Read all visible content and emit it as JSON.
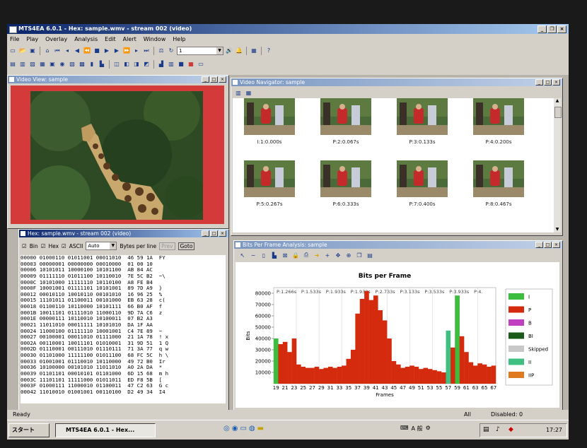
{
  "app": {
    "title": "MTS4EA 6.0.1 - Hex: sample.wmv - stream 002 (video)"
  },
  "menu": [
    "File",
    "Play",
    "Overlay",
    "Analysis",
    "Edit",
    "Alert",
    "Window",
    "Help"
  ],
  "toolbar": {
    "speed_value": "1"
  },
  "video_view": {
    "title": "Video View: sample"
  },
  "navigator": {
    "title": "Video Navigator: sample",
    "thumbs": [
      "I:1:0.000s",
      "P:2:0.067s",
      "P:3:0.133s",
      "P:4:0.200s",
      "P:5:0.267s",
      "P:6:0.333s",
      "P:7:0.400s",
      "P:8:0.467s"
    ]
  },
  "hex": {
    "title": "Hex: sample.wmv - stream 002 (video)",
    "bin_label": "Bin",
    "hex_label": "Hex",
    "ascii_label": "ASCII",
    "bytes_combo": "Auto",
    "bytes_label": "Bytes per line",
    "prev_label": "Prev",
    "goto_label": "Goto",
    "rows": [
      "00000 01000110 01011001 00011010  46 59 1A  FY",
      "00003 00000001 00000000 00010000  01 00 10",
      "00006 10101011 10000100 10101100  AB 84 AC",
      "00009 01111110 01011100 10110010  7E 5C B2  ~\\",
      "0000C 10101000 11111110 10110100  A8 FE B4",
      "0000F 10001001 01111101 10101001  89 7D A9  }",
      "00012 00010110 10010110 00101010  16 96 25  %",
      "00015 11101011 01100011 00101000  EB 63 28  c(",
      "00018 01100110 10110000 10101111  66 B0 AF  f",
      "0001B 10011101 01111010 11000110  9D 7A C6  z",
      "0001E 00000111 10110010 10100011  07 B2 A3",
      "00021 11011010 00011111 10101010  DA 1F AA",
      "00024 11000100 01111110 10001001  C4 7E 89  ~",
      "00027 00100001 00011010 01111000  21 1A 78  ! x",
      "0002A 00110001 10011101 01010001  31 9D 51  1 Q",
      "0002D 01110001 00111010 01110111  71 3A 77  q w",
      "00030 01101000 11111100 01011100  68 FC 5C  h \\",
      "00033 01001001 01110010 10110000  49 72 B0  Ir",
      "00036 10100000 00101010 11011010  A0 2A DA  *",
      "00039 01101101 00010101 01101000  6D 15 68  m h",
      "0003C 11101101 11111000 01011011  ED F8 5B  [",
      "0003F 01000111 11000010 01100011  47 C2 63  G c",
      "00042 11010010 01001001 00110100  D2 49 34  I4"
    ]
  },
  "bpf": {
    "title": "Bits Per Frame Analysis: sample",
    "tag_labels": [
      "P:1.266s",
      "P:1.533s",
      "P:1.933s",
      "P:1.933s",
      "P:2.733s",
      "P:3.133s",
      "P:3.533s",
      "P:3.933s",
      "P:4."
    ],
    "legend": [
      {
        "label": "I",
        "color": "#3dbd3d"
      },
      {
        "label": "P",
        "color": "#d42a0e"
      },
      {
        "label": "B",
        "color": "#c040c0"
      },
      {
        "label": "BI",
        "color": "#1a5a1a"
      },
      {
        "label": "Skipped",
        "color": "#c8c8c8"
      },
      {
        "label": "II",
        "color": "#40c080"
      },
      {
        "label": "IIP",
        "color": "#e07a20"
      }
    ]
  },
  "chart_data": {
    "type": "bar",
    "title": "Bits per Frame",
    "xlabel": "Frames",
    "ylabel": "Bits",
    "ylim": [
      0,
      85000
    ],
    "yticks": [
      10000,
      20000,
      30000,
      40000,
      50000,
      60000,
      70000,
      80000
    ],
    "x": [
      19,
      20,
      21,
      22,
      23,
      24,
      25,
      26,
      27,
      28,
      29,
      30,
      31,
      32,
      33,
      34,
      35,
      36,
      37,
      38,
      39,
      40,
      41,
      42,
      43,
      44,
      45,
      46,
      47,
      48,
      49,
      50,
      51,
      52,
      53,
      54,
      55,
      56,
      57,
      58,
      59,
      60,
      61,
      62,
      63,
      64,
      65,
      66,
      67
    ],
    "xticks": [
      19,
      21,
      23,
      25,
      27,
      29,
      31,
      33,
      35,
      37,
      39,
      41,
      43,
      45,
      47,
      49,
      51,
      53,
      55,
      57,
      59,
      61,
      63,
      65,
      67
    ],
    "series": [
      {
        "name": "I",
        "values": [
          40000,
          0,
          0,
          0,
          0,
          0,
          0,
          0,
          0,
          0,
          0,
          0,
          0,
          0,
          0,
          0,
          0,
          0,
          0,
          0,
          0,
          0,
          0,
          0,
          0,
          0,
          0,
          0,
          0,
          0,
          0,
          0,
          0,
          0,
          0,
          0,
          0,
          0,
          0,
          0,
          78000,
          0,
          0,
          0,
          0,
          0,
          0,
          0,
          0
        ]
      },
      {
        "name": "P",
        "values": [
          0,
          35000,
          37000,
          28000,
          40000,
          17000,
          15000,
          14000,
          14000,
          15000,
          13000,
          14000,
          15000,
          14000,
          15000,
          16000,
          22000,
          30000,
          62000,
          75000,
          82000,
          74000,
          78000,
          65000,
          56000,
          40000,
          20000,
          17000,
          14000,
          15000,
          16000,
          15000,
          13000,
          14000,
          13000,
          12000,
          11000,
          10000,
          13000,
          32000,
          0,
          42000,
          28000,
          19000,
          16000,
          18000,
          17000,
          15000,
          16000
        ]
      },
      {
        "name": "II",
        "values": [
          0,
          0,
          0,
          0,
          0,
          0,
          0,
          0,
          0,
          0,
          0,
          0,
          0,
          0,
          0,
          0,
          0,
          0,
          0,
          0,
          0,
          0,
          0,
          0,
          0,
          0,
          0,
          0,
          0,
          0,
          0,
          0,
          0,
          0,
          0,
          0,
          0,
          0,
          47000,
          0,
          0,
          0,
          0,
          0,
          0,
          0,
          0,
          0,
          0
        ]
      }
    ]
  },
  "status": {
    "ready": "Ready",
    "all": "All",
    "disabled": "Disabled: 0"
  },
  "taskbar": {
    "start": "スタート",
    "task": "MTS4EA 6.0.1 - Hex...",
    "ime": "A 般",
    "clock": "17:27"
  }
}
